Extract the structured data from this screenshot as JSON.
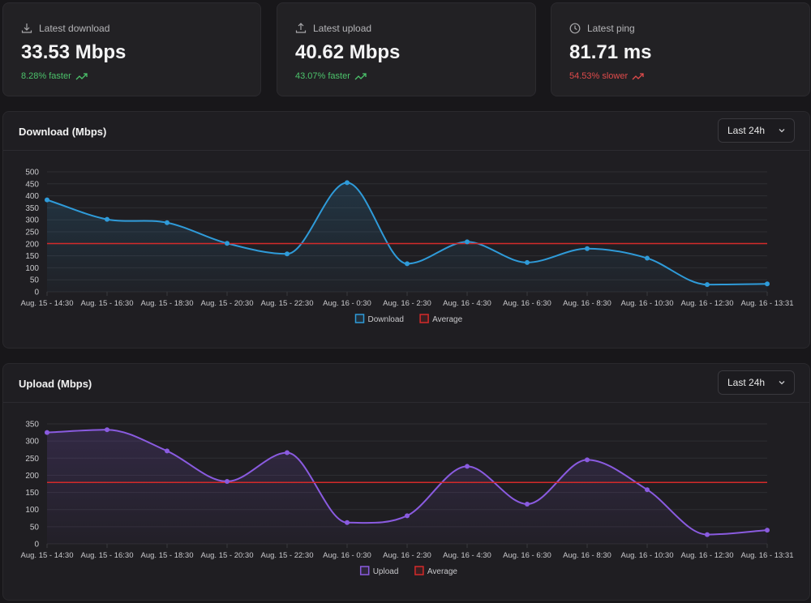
{
  "stats": [
    {
      "label": "Latest download",
      "value": "33.53 Mbps",
      "change": "8.28% faster",
      "icon": "download-icon",
      "trend": "up"
    },
    {
      "label": "Latest upload",
      "value": "40.62 Mbps",
      "change": "43.07% faster",
      "icon": "upload-icon",
      "trend": "up"
    },
    {
      "label": "Latest ping",
      "value": "81.71 ms",
      "change": "54.53% slower",
      "icon": "clock-icon",
      "trend": "down"
    }
  ],
  "range_select": {
    "value": "Last 24h"
  },
  "colors": {
    "download": "#2f9bd9",
    "upload": "#8a5be0",
    "average": "#d42a2a",
    "up": "#4cc36b",
    "down": "#e04b4b"
  },
  "chart_data": [
    {
      "type": "line",
      "title": "Download (Mbps)",
      "categories": [
        "Aug. 15 - 14:30",
        "Aug. 15 - 16:30",
        "Aug. 15 - 18:30",
        "Aug. 15 - 20:30",
        "Aug. 15 - 22:30",
        "Aug. 16 - 0:30",
        "Aug. 16 - 2:30",
        "Aug. 16 - 4:30",
        "Aug. 16 - 6:30",
        "Aug. 16 - 8:30",
        "Aug. 16 - 10:30",
        "Aug. 16 - 12:30",
        "Aug. 16 - 13:31"
      ],
      "series": [
        {
          "name": "Download",
          "values": [
            383,
            302,
            288,
            202,
            158,
            455,
            117,
            208,
            122,
            180,
            140,
            30,
            33
          ]
        },
        {
          "name": "Average",
          "values": [
            201,
            201,
            201,
            201,
            201,
            201,
            201,
            201,
            201,
            201,
            201,
            201,
            201
          ]
        }
      ],
      "yticks": [
        0,
        50,
        100,
        150,
        200,
        250,
        300,
        350,
        400,
        450,
        500
      ],
      "ylim": [
        0,
        500
      ],
      "legend": "bottom",
      "grid": true
    },
    {
      "type": "line",
      "title": "Upload (Mbps)",
      "categories": [
        "Aug. 15 - 14:30",
        "Aug. 15 - 16:30",
        "Aug. 15 - 18:30",
        "Aug. 15 - 20:30",
        "Aug. 15 - 22:30",
        "Aug. 16 - 0:30",
        "Aug. 16 - 2:30",
        "Aug. 16 - 4:30",
        "Aug. 16 - 6:30",
        "Aug. 16 - 8:30",
        "Aug. 16 - 10:30",
        "Aug. 16 - 12:30",
        "Aug. 16 - 13:31"
      ],
      "series": [
        {
          "name": "Upload",
          "values": [
            325,
            333,
            271,
            182,
            266,
            62,
            82,
            226,
            116,
            245,
            158,
            27,
            40
          ]
        },
        {
          "name": "Average",
          "values": [
            179,
            179,
            179,
            179,
            179,
            179,
            179,
            179,
            179,
            179,
            179,
            179,
            179
          ]
        }
      ],
      "yticks": [
        0,
        50,
        100,
        150,
        200,
        250,
        300,
        350
      ],
      "ylim": [
        0,
        350
      ],
      "legend": "bottom",
      "grid": true
    }
  ]
}
